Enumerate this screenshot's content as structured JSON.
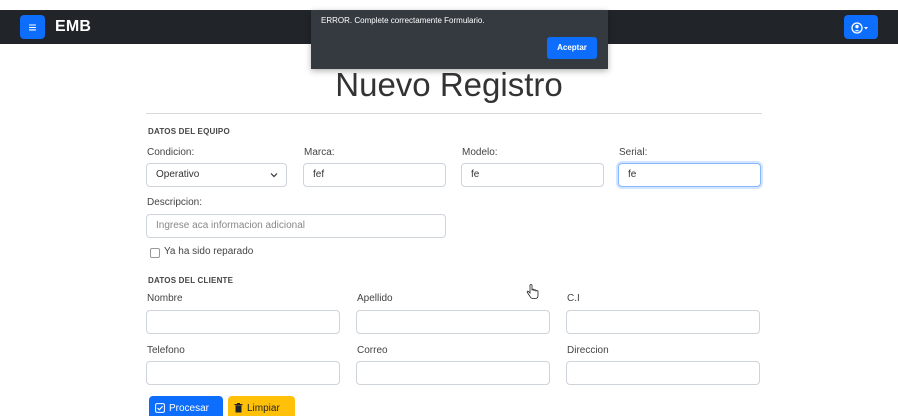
{
  "navbar": {
    "menu_icon": "hamburger-icon",
    "brand": "EMB",
    "user_icon": "user-circle-icon"
  },
  "alert": {
    "message": "ERROR. Complete correctamente Formulario.",
    "ok_label": "Aceptar"
  },
  "page": {
    "title": "Nuevo Registro"
  },
  "equipo": {
    "section_title": "DATOS DEL EQUIPO",
    "condicion": {
      "label": "Condicion:",
      "value": "Operativo"
    },
    "marca": {
      "label": "Marca:",
      "value": "fef"
    },
    "modelo": {
      "label": "Modelo:",
      "value": "fe"
    },
    "serial": {
      "label": "Serial:",
      "value": "fe"
    },
    "descripcion": {
      "label": "Descripcion:",
      "placeholder": "Ingrese aca informacion adicional"
    },
    "reparado_label": "Ya ha sido reparado"
  },
  "cliente": {
    "section_title": "DATOS DEL CLIENTE",
    "nombre_label": "Nombre",
    "apellido_label": "Apellido",
    "ci_label": "C.I",
    "telefono_label": "Telefono",
    "correo_label": "Correo",
    "direccion_label": "Direccion"
  },
  "actions": {
    "procesar_label": "Procesar",
    "limpiar_label": "Limpiar"
  },
  "colors": {
    "primary": "#0d6efd",
    "warning": "#ffc107",
    "navbar": "#212529",
    "alert_bg": "#343a40"
  }
}
